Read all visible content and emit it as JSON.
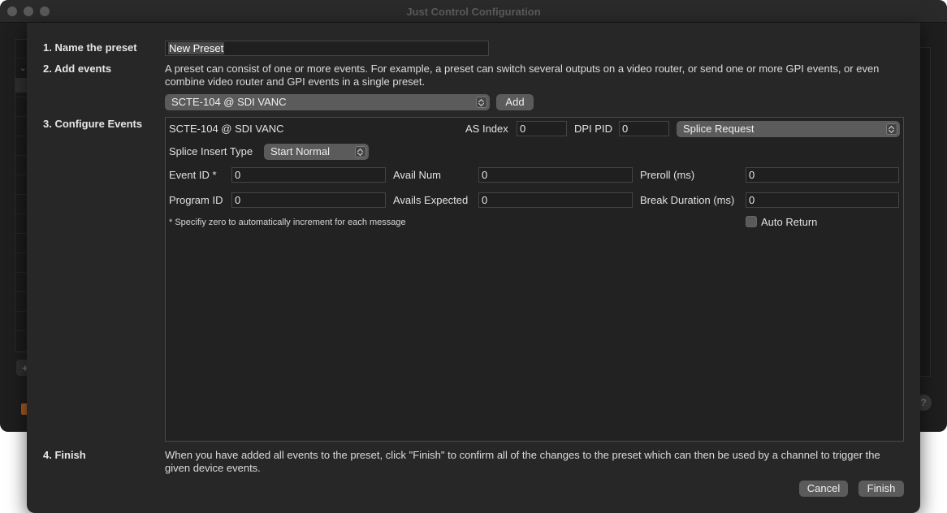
{
  "window": {
    "title": "Just Control Configuration"
  },
  "steps": {
    "name": {
      "label": "1. Name the preset",
      "value": "New Preset"
    },
    "add": {
      "label": "2. Add events",
      "description": "A preset can consist of one or more events. For example, a preset can switch several outputs on a video router, or send one or more GPI events, or even combine video router and GPI events in a single preset.",
      "event_type_selected": "SCTE-104 @ SDI VANC",
      "add_button": "Add"
    },
    "configure": {
      "label": "3. Configure Events"
    },
    "finish": {
      "label": "4. Finish",
      "description": "When you have added all events to the preset, click \"Finish\" to confirm all of the changes to the preset which can then be used by a channel to trigger the given device events."
    }
  },
  "event": {
    "title": "SCTE-104 @ SDI VANC",
    "as_index_label": "AS Index",
    "as_index_value": "0",
    "dpi_pid_label": "DPI PID",
    "dpi_pid_value": "0",
    "request_type": "Splice Request",
    "splice_insert_type_label": "Splice Insert Type",
    "splice_insert_type_value": "Start Normal",
    "event_id_label": "Event ID *",
    "event_id_value": "0",
    "avail_num_label": "Avail Num",
    "avail_num_value": "0",
    "preroll_label": "Preroll (ms)",
    "preroll_value": "0",
    "program_id_label": "Program ID",
    "program_id_value": "0",
    "avails_expected_label": "Avails Expected",
    "avails_expected_value": "0",
    "break_duration_label": "Break Duration (ms)",
    "break_duration_value": "0",
    "note": "* Specifiy zero to automatically increment for each message",
    "auto_return_label": "Auto Return",
    "auto_return_checked": false
  },
  "buttons": {
    "cancel": "Cancel",
    "finish": "Finish"
  }
}
